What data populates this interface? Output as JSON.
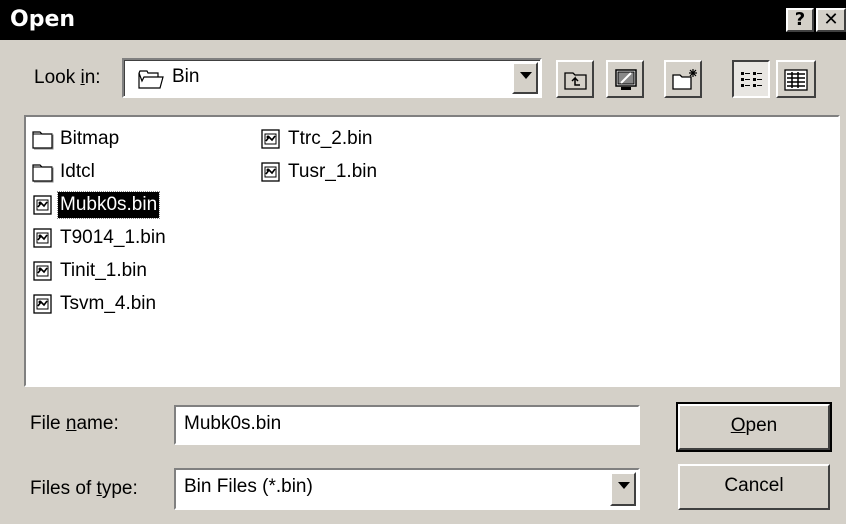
{
  "window": {
    "title": "Open",
    "help_button": "?",
    "close_button": "✕"
  },
  "look_in": {
    "label_pre": "Look ",
    "label_accel": "i",
    "label_post": "n:",
    "value": "Bin"
  },
  "files": {
    "column1": [
      {
        "name": "Bitmap",
        "type": "folder"
      },
      {
        "name": "Idtcl",
        "type": "folder"
      },
      {
        "name": "Mubk0s.bin",
        "type": "file",
        "selected": true
      },
      {
        "name": "T9014_1.bin",
        "type": "file"
      },
      {
        "name": "Tinit_1.bin",
        "type": "file"
      },
      {
        "name": "Tsvm_4.bin",
        "type": "file"
      }
    ],
    "column2": [
      {
        "name": "Ttrc_2.bin",
        "type": "file"
      },
      {
        "name": "Tusr_1.bin",
        "type": "file"
      }
    ]
  },
  "file_name": {
    "label_pre": "File ",
    "label_accel": "n",
    "label_post": "ame:",
    "value": "Mubk0s.bin"
  },
  "file_type": {
    "label_pre": "Files of ",
    "label_accel": "t",
    "label_post": "ype:",
    "value": "Bin Files (*.bin)"
  },
  "buttons": {
    "open_accel": "O",
    "open_rest": "pen",
    "cancel": "Cancel"
  },
  "icons": {
    "up_folder": "up-folder-icon",
    "desktop": "desktop-icon",
    "new_folder": "new-folder-icon",
    "list_view": "list-view-icon",
    "details_view": "details-view-icon"
  }
}
